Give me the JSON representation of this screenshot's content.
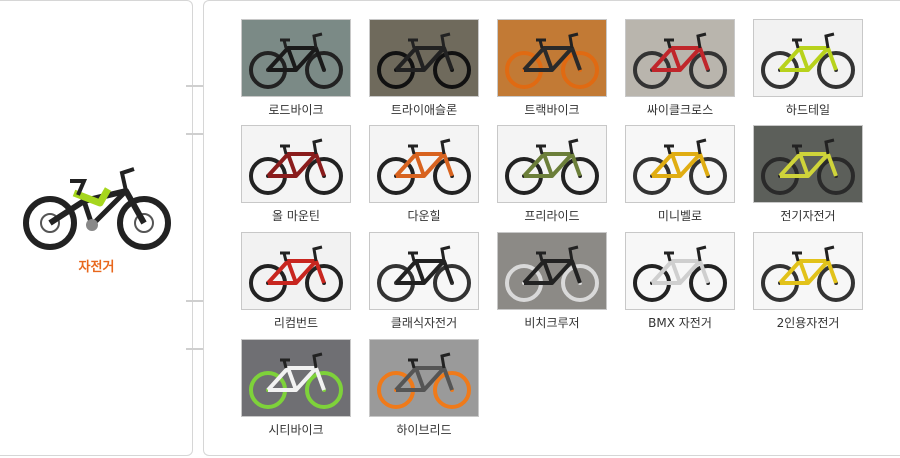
{
  "category": {
    "name": "자전거",
    "accent_color": "#e8671c",
    "icon": "bicycle-icon"
  },
  "bikes": [
    {
      "label": "로드바이크",
      "icon": "road-bike-image",
      "bg": "#7b8a86",
      "frame": "#1a1a1a",
      "wheel": "#222222"
    },
    {
      "label": "트라이애슬론",
      "icon": "triathlon-bike-image",
      "bg": "#6f6a5c",
      "frame": "#222222",
      "wheel": "#111111"
    },
    {
      "label": "트랙바이크",
      "icon": "track-bike-image",
      "bg": "#c27a35",
      "frame": "#2a2a2a",
      "wheel": "#e06a12"
    },
    {
      "label": "싸이클크로스",
      "icon": "cyclocross-bike-image",
      "bg": "#b9b5ad",
      "frame": "#c0262b",
      "wheel": "#333333"
    },
    {
      "label": "하드테일",
      "icon": "hardtail-bike-image",
      "bg": "#f2f2f2",
      "frame": "#b8d21c",
      "wheel": "#333333"
    },
    {
      "label": "올 마운틴",
      "icon": "all-mountain-bike-image",
      "bg": "#f4f4f4",
      "frame": "#8a1c1c",
      "wheel": "#222222"
    },
    {
      "label": "다운힐",
      "icon": "downhill-bike-image",
      "bg": "#f4f4f4",
      "frame": "#d8631f",
      "wheel": "#222222"
    },
    {
      "label": "프리라이드",
      "icon": "freeride-bike-image",
      "bg": "#f4f4f4",
      "frame": "#6c7f3a",
      "wheel": "#222222"
    },
    {
      "label": "미니벨로",
      "icon": "minivelo-bike-image",
      "bg": "#f7f7f7",
      "frame": "#e0ad12",
      "wheel": "#333333"
    },
    {
      "label": "전기자전거",
      "icon": "electric-bike-image",
      "bg": "#5c5f5a",
      "frame": "#cfd43a",
      "wheel": "#2a2a2a"
    },
    {
      "label": "리컴번트",
      "icon": "recumbent-bike-image",
      "bg": "#f2f2f2",
      "frame": "#c8261f",
      "wheel": "#222222"
    },
    {
      "label": "클래식자전거",
      "icon": "classic-bike-image",
      "bg": "#f7f7f7",
      "frame": "#222222",
      "wheel": "#333333"
    },
    {
      "label": "비치크루저",
      "icon": "beach-cruiser-image",
      "bg": "#8c8a86",
      "frame": "#222222",
      "wheel": "#d9d9d9"
    },
    {
      "label": "BMX 자전거",
      "icon": "bmx-bike-image",
      "bg": "#f7f7f7",
      "frame": "#cfcfcf",
      "wheel": "#222222"
    },
    {
      "label": "2인용자전거",
      "icon": "tandem-bike-image",
      "bg": "#f7f7f7",
      "frame": "#e2c21a",
      "wheel": "#333333"
    },
    {
      "label": "시티바이크",
      "icon": "city-bike-image",
      "bg": "#6f6f73",
      "frame": "#f2f2f2",
      "wheel": "#7ed23a"
    },
    {
      "label": "하이브리드",
      "icon": "hybrid-bike-image",
      "bg": "#9a9a9a",
      "frame": "#555555",
      "wheel": "#ef7a1a"
    }
  ]
}
